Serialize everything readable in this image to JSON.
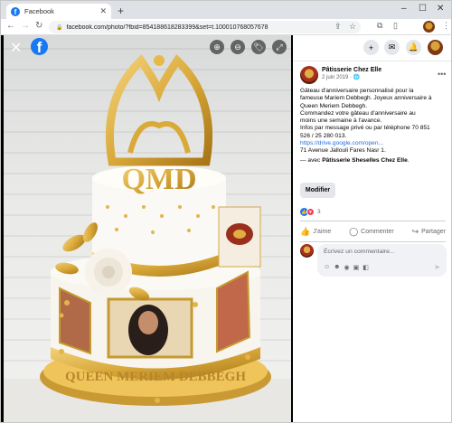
{
  "browser": {
    "tab_title": "Facebook",
    "url": "facebook.com/photo/?fbid=854188618283399&set=t.100010768057678"
  },
  "post": {
    "author": "Pâtisserie Chez Elle",
    "date": "2 juin 2019 ·",
    "caption_lines": [
      "Gâteau d'anniversaire personnalisé pour la",
      "fameuse Mariem Debbegh. Joyeux anniversaire à",
      "Queen Meriem Debbegh.",
      "Commandez votre gâteau d'anniversaire au",
      "moins une semaine à l'avance.",
      "Infos par message privé ou par téléphone 70 851",
      "526 / 25 280 013.",
      "https://drive.google.com/open...",
      "71 Avenue Jallouli Fares Nasr 1."
    ],
    "tag_prefix": "— avec ",
    "tag_name": "Pâtisserie Sheselles Chez Elle",
    "tag_suffix": ".",
    "edit_button": "Modifier",
    "reaction_count": "3",
    "actions": {
      "like": "J'aime",
      "comment": "Commenter",
      "share": "Partager"
    },
    "comment_placeholder": "Écrivez un commentaire..."
  },
  "cake_text": {
    "crown_letters": "QMD",
    "ribbon": "QUEEN MERIEM DEBBEGH"
  },
  "colors": {
    "facebook_blue": "#1877f2",
    "link": "#216fdb",
    "gold": "#d9a93a"
  },
  "icons": [
    "facebook-logo",
    "close-icon",
    "zoom-in-icon",
    "zoom-out-icon",
    "tag-icon",
    "fullscreen-icon",
    "plus-icon",
    "messenger-icon",
    "bell-icon",
    "like-icon",
    "comment-icon",
    "share-icon",
    "send-icon"
  ]
}
